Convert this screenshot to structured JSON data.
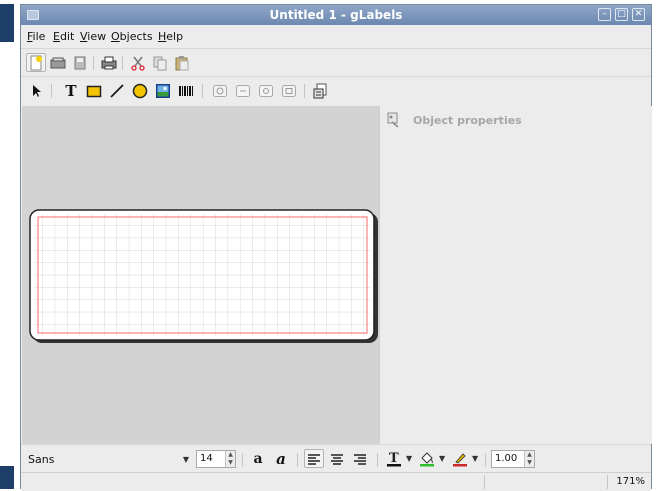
{
  "window": {
    "title": "Untitled 1 - gLabels"
  },
  "menubar": {
    "items": [
      {
        "label": "File"
      },
      {
        "label": "Edit"
      },
      {
        "label": "View"
      },
      {
        "label": "Objects"
      },
      {
        "label": "Help"
      }
    ]
  },
  "toolbar_main": {
    "buttons": [
      "new-icon",
      "open-icon",
      "save-icon",
      "print-icon",
      "cut-icon",
      "copy-icon",
      "paste-icon"
    ]
  },
  "toolbar_objects": {
    "buttons": [
      "arrow-icon",
      "text-icon",
      "box-icon",
      "line-icon",
      "ellipse-icon",
      "image-icon",
      "barcode-icon",
      "zoom-in-icon",
      "zoom-out-icon",
      "zoom-1to1-icon",
      "zoom-fit-icon",
      "merge-icon"
    ],
    "text_tool_glyph": "T"
  },
  "properties": {
    "label": "Object properties"
  },
  "format": {
    "font_family": "Sans",
    "font_size": "14",
    "line_width": "1.00",
    "colors": {
      "text": "#111111",
      "fill": "#2fbf2f",
      "line": "#cc2b2b"
    }
  },
  "status": {
    "zoom": "171%"
  },
  "label_canvas": {
    "outline_color": "#ff6b6b",
    "grid_color": "#c9c9c9"
  }
}
